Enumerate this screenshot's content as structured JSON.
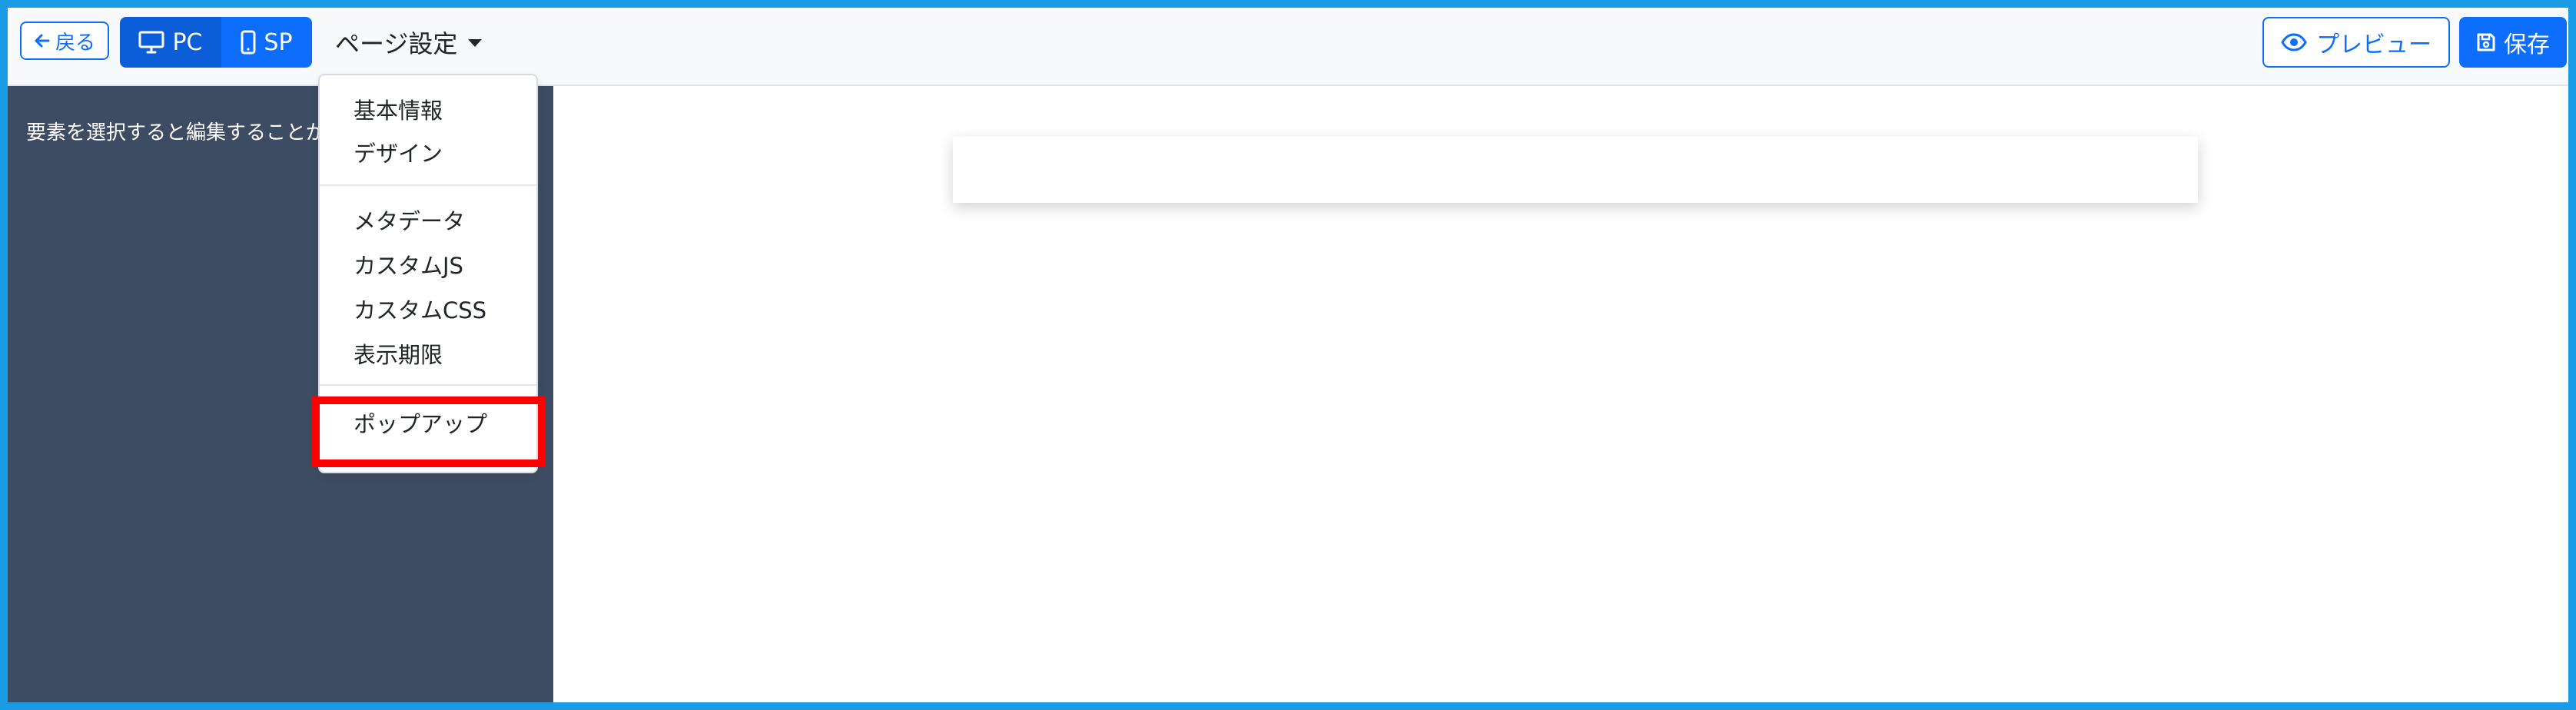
{
  "toolbar": {
    "back_label": "戻る",
    "pc_label": "PC",
    "sp_label": "SP",
    "page_settings_label": "ページ設定",
    "preview_label": "プレビュー",
    "save_label": "保存"
  },
  "sidebar": {
    "hint": "要素を選択すると編集することが"
  },
  "dropdown": {
    "items": [
      {
        "label": "基本情報"
      },
      {
        "label": "デザイン"
      },
      {
        "label": "メタデータ"
      },
      {
        "label": "カスタムJS"
      },
      {
        "label": "カスタムCSS"
      },
      {
        "label": "表示期限"
      },
      {
        "label": "ポップアップ"
      }
    ]
  },
  "colors": {
    "primary": "#0d6efd",
    "primary_dark": "#0b5ed7",
    "sidebar_bg": "#3e4c63",
    "frame_border": "#1a9be6",
    "highlight": "#ff0000"
  },
  "icons": {
    "back": "arrow-left-icon",
    "pc": "desktop-icon",
    "sp": "mobile-icon",
    "preview": "eye-icon",
    "save": "floppy-disk-icon"
  }
}
